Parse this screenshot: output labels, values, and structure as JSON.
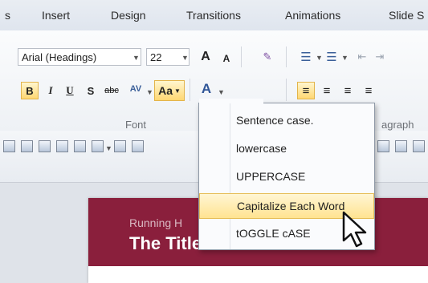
{
  "tabs": [
    "s",
    "Insert",
    "Design",
    "Transitions",
    "Animations",
    "Slide S"
  ],
  "font": {
    "name_value": "Arial (Headings)",
    "size_value": "22",
    "grow_label": "A",
    "shrink_label": "A",
    "bold_label": "B",
    "italic_label": "I",
    "underline_label": "U",
    "shadow_label": "S",
    "strike_label": "abc",
    "spacing_label": "AV",
    "case_label": "Aa",
    "color_label": "A"
  },
  "groups": {
    "font_label": "Font",
    "paragraph_label": "agraph"
  },
  "menu": {
    "items": [
      "Sentence case.",
      "lowercase",
      "UPPERCASE",
      "Capitalize Each Word",
      "tOGGLE cASE"
    ]
  },
  "slide": {
    "running_header": "Running H",
    "title": "The Title of This Document"
  }
}
